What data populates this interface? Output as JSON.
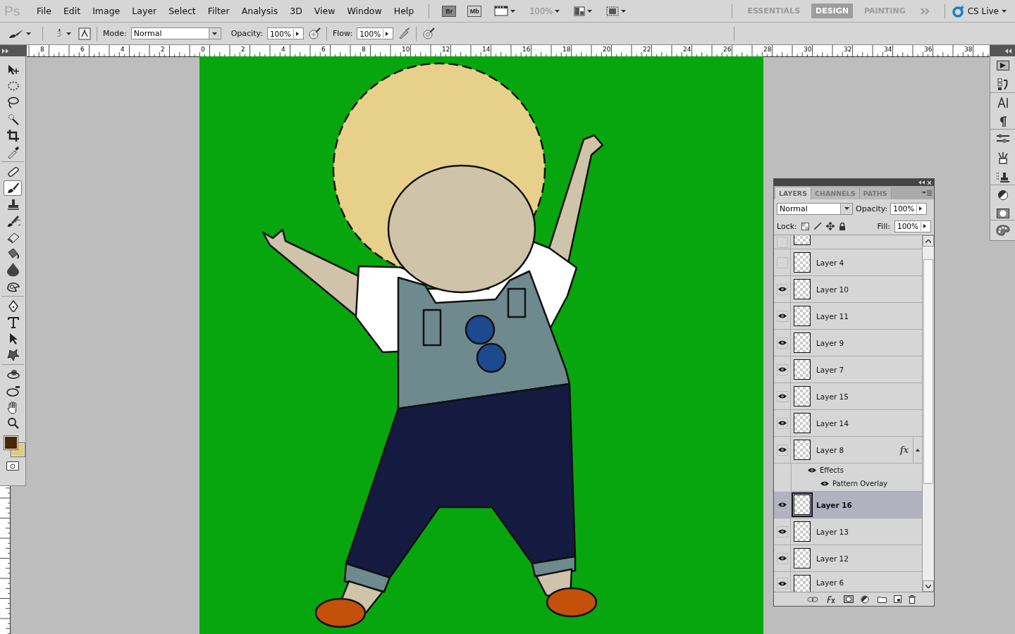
{
  "menu_bar": {
    "logo": "Ps",
    "items": [
      "File",
      "Edit",
      "Image",
      "Layer",
      "Select",
      "Filter",
      "Analysis",
      "3D",
      "View",
      "Window",
      "Help"
    ],
    "bridge": "Br",
    "mini_bridge": "Mb",
    "zoom": "100%",
    "workspaces": [
      {
        "label": "ESSENTIALS",
        "selected": false
      },
      {
        "label": "DESIGN",
        "selected": true
      },
      {
        "label": "PAINTING",
        "selected": false
      }
    ],
    "cs_live": "CS Live"
  },
  "options_bar": {
    "brush_size": "3",
    "mode_label": "Mode:",
    "mode": "Normal",
    "opacity_label": "Opacity:",
    "opacity": "100%",
    "flow_label": "Flow:",
    "flow": "100%"
  },
  "ruler": {
    "labels": [
      "8",
      "6",
      "4",
      "2",
      "0",
      "2",
      "4",
      "6",
      "8",
      "10",
      "12",
      "14",
      "16",
      "18",
      "20",
      "22",
      "24",
      "26",
      "28",
      "30",
      "32",
      "34",
      "36",
      "38"
    ]
  },
  "tools": [
    {
      "kind": "move",
      "selected": false
    },
    {
      "kind": "marquee",
      "selected": false
    },
    {
      "kind": "lasso",
      "selected": false
    },
    {
      "kind": "quick-select",
      "selected": false
    },
    {
      "kind": "crop",
      "selected": false
    },
    {
      "kind": "eyedropper",
      "selected": false
    },
    {
      "kind": "separator"
    },
    {
      "kind": "healing",
      "selected": false
    },
    {
      "kind": "brush",
      "selected": true
    },
    {
      "kind": "stamp",
      "selected": false
    },
    {
      "kind": "history-brush",
      "selected": false
    },
    {
      "kind": "eraser",
      "selected": false
    },
    {
      "kind": "bucket",
      "selected": false
    },
    {
      "kind": "blur",
      "selected": false
    },
    {
      "kind": "dodge",
      "selected": false
    },
    {
      "kind": "separator"
    },
    {
      "kind": "pen",
      "selected": false
    },
    {
      "kind": "type",
      "selected": false
    },
    {
      "kind": "path-select",
      "selected": false
    },
    {
      "kind": "shape",
      "selected": false
    },
    {
      "kind": "separator"
    },
    {
      "kind": "rotate-3d",
      "selected": false
    },
    {
      "kind": "orbit-3d",
      "selected": false
    },
    {
      "kind": "hand",
      "selected": false
    },
    {
      "kind": "zoom",
      "selected": false
    }
  ],
  "layers_panel": {
    "tabs": [
      {
        "label": "LAYERS",
        "selected": true
      },
      {
        "label": "CHANNELS",
        "selected": false
      },
      {
        "label": "PATHS",
        "selected": false
      }
    ],
    "blend_mode": "Normal",
    "opacity_label": "Opacity:",
    "opacity": "100%",
    "lock_label": "Lock:",
    "fill_label": "Fill:",
    "fill": "100%",
    "rows": [
      {
        "kind": "partial",
        "visible": false
      },
      {
        "kind": "layer",
        "name": "Layer 4",
        "visible": false,
        "selected": false
      },
      {
        "kind": "layer",
        "name": "Layer 10",
        "visible": true,
        "selected": false
      },
      {
        "kind": "layer",
        "name": "Layer 11",
        "visible": true,
        "selected": false
      },
      {
        "kind": "layer",
        "name": "Layer 9",
        "visible": true,
        "selected": false
      },
      {
        "kind": "layer",
        "name": "Layer 7",
        "visible": true,
        "selected": false
      },
      {
        "kind": "layer",
        "name": "Layer 15",
        "visible": true,
        "selected": false
      },
      {
        "kind": "layer",
        "name": "Layer 14",
        "visible": true,
        "selected": false
      },
      {
        "kind": "layer",
        "name": "Layer 8",
        "visible": true,
        "selected": false,
        "fx_badge": "fx",
        "expanded": true,
        "effects": {
          "label": "Effects",
          "visible": true,
          "children": [
            {
              "name": "Pattern Overlay",
              "visible": true
            }
          ]
        }
      },
      {
        "kind": "layer",
        "name": "Layer 16",
        "visible": true,
        "selected": true
      },
      {
        "kind": "layer",
        "name": "Layer 13",
        "visible": true,
        "selected": false
      },
      {
        "kind": "layer",
        "name": "Layer 12",
        "visible": true,
        "selected": false
      },
      {
        "kind": "last",
        "name": "Layer 6",
        "visible": true,
        "selected": false
      }
    ]
  }
}
